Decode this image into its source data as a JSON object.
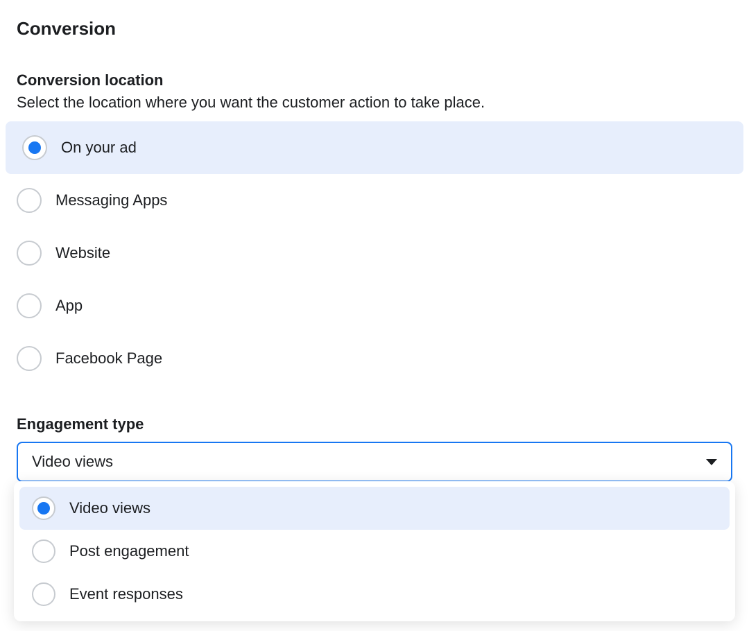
{
  "section": {
    "title": "Conversion"
  },
  "conversion_location": {
    "title": "Conversion location",
    "description": "Select the location where you want the customer action to take place.",
    "options": [
      {
        "label": "On your ad",
        "selected": true
      },
      {
        "label": "Messaging Apps",
        "selected": false
      },
      {
        "label": "Website",
        "selected": false
      },
      {
        "label": "App",
        "selected": false
      },
      {
        "label": "Facebook Page",
        "selected": false
      }
    ]
  },
  "engagement_type": {
    "title": "Engagement type",
    "selected_value": "Video views",
    "options": [
      {
        "label": "Video views",
        "selected": true
      },
      {
        "label": "Post engagement",
        "selected": false
      },
      {
        "label": "Event responses",
        "selected": false
      }
    ]
  }
}
